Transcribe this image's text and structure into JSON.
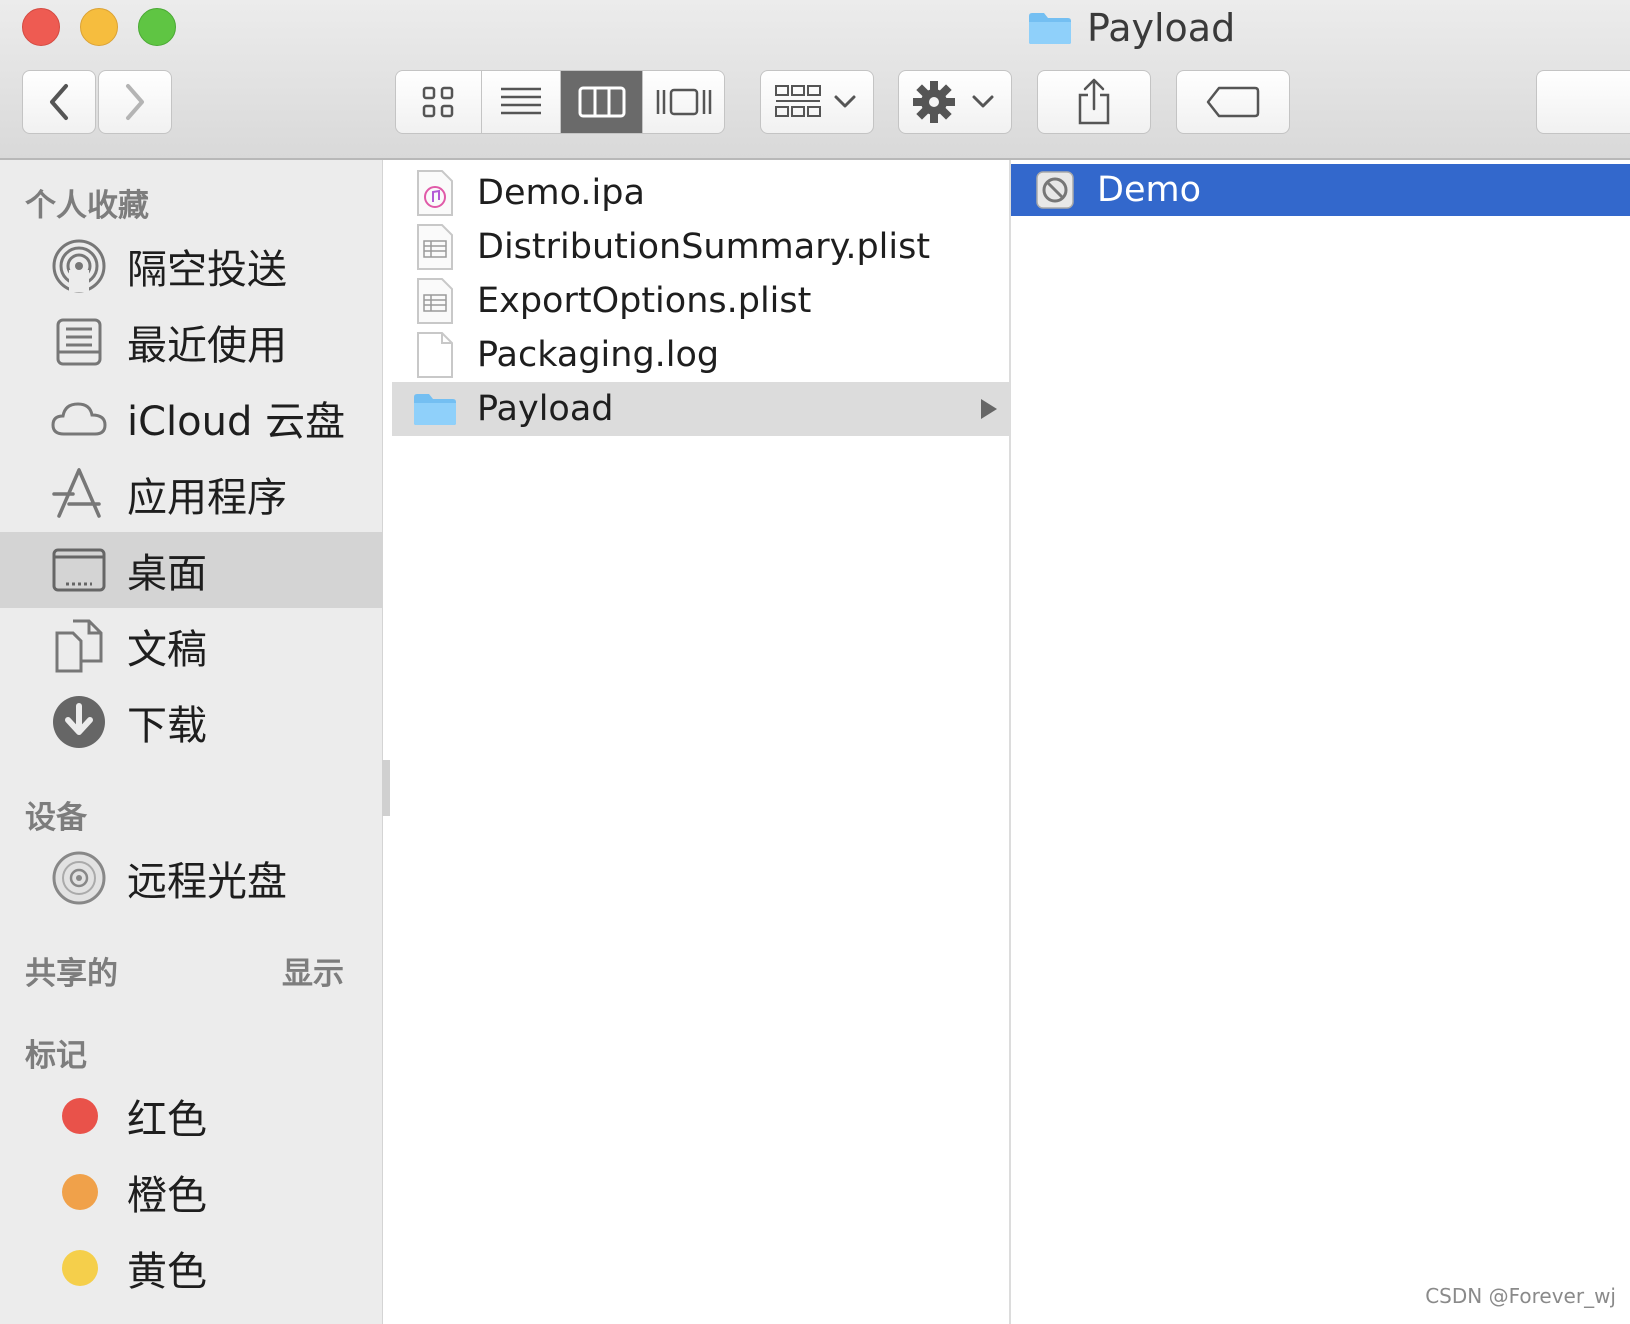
{
  "window": {
    "title": "Payload"
  },
  "toolbar": {
    "back_icon": "chevron-left-icon",
    "forward_icon": "chevron-right-icon",
    "view_modes": [
      "icon-view-icon",
      "list-view-icon",
      "column-view-icon",
      "gallery-view-icon"
    ],
    "active_view": "column",
    "group_icon": "group-grid-icon",
    "action_icon": "gear-icon",
    "share_icon": "share-icon",
    "tag_icon": "tag-icon"
  },
  "sidebar": {
    "favorites_header": "个人收藏",
    "favorites": [
      {
        "label": "隔空投送",
        "icon": "airdrop-icon"
      },
      {
        "label": "最近使用",
        "icon": "recents-icon"
      },
      {
        "label": "iCloud 云盘",
        "icon": "cloud-icon"
      },
      {
        "label": "应用程序",
        "icon": "applications-icon"
      },
      {
        "label": "桌面",
        "icon": "desktop-icon",
        "selected": true
      },
      {
        "label": "文稿",
        "icon": "documents-icon"
      },
      {
        "label": "下载",
        "icon": "download-icon"
      }
    ],
    "devices_header": "设备",
    "devices": [
      {
        "label": "远程光盘",
        "icon": "disc-icon"
      }
    ],
    "shared_header": "共享的",
    "shared_action": "显示",
    "tags_header": "标记",
    "tags": [
      {
        "label": "红色",
        "color": "#e9524a"
      },
      {
        "label": "橙色",
        "color": "#f0a14a"
      },
      {
        "label": "黄色",
        "color": "#f5cf4b"
      }
    ]
  },
  "column1": {
    "files": [
      {
        "name": "Demo.ipa",
        "icon": "ipa-file-icon"
      },
      {
        "name": "DistributionSummary.plist",
        "icon": "plist-file-icon"
      },
      {
        "name": "ExportOptions.plist",
        "icon": "plist-file-icon"
      },
      {
        "name": "Packaging.log",
        "icon": "log-file-icon"
      },
      {
        "name": "Payload",
        "icon": "folder-icon",
        "selected": true
      }
    ]
  },
  "column2": {
    "files": [
      {
        "name": "Demo",
        "icon": "app-icon",
        "selected": true
      }
    ]
  },
  "colors": {
    "selection_blue": "#3368cc",
    "folder_blue": "#6cb7ee"
  },
  "watermark": "CSDN @Forever_wj"
}
